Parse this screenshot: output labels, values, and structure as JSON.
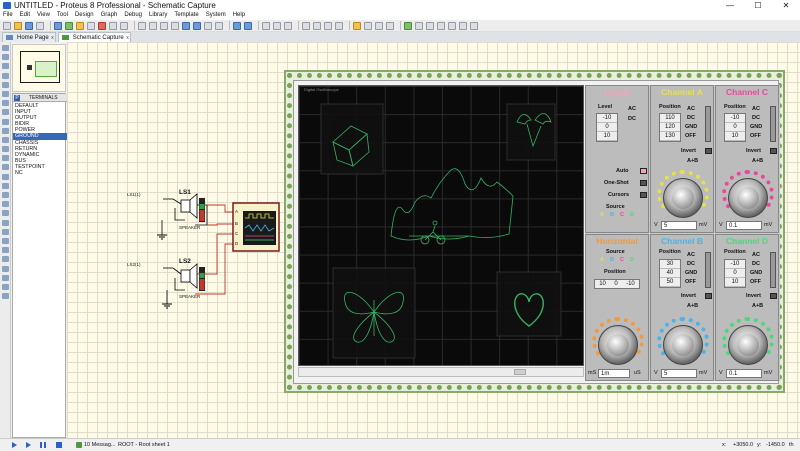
{
  "window": {
    "title": "UNTITLED - Proteus 8 Professional - Schematic Capture",
    "min": "—",
    "max": "☐",
    "close": "✕"
  },
  "menu": [
    "File",
    "Edit",
    "View",
    "Tool",
    "Design",
    "Graph",
    "Debug",
    "Library",
    "Template",
    "System",
    "Help"
  ],
  "tabs": [
    {
      "label": "Home Page",
      "active": false
    },
    {
      "label": "Schematic Capture",
      "active": true
    }
  ],
  "tab_close": "x",
  "terminals": {
    "p_label": "P",
    "header": "TERMINALS",
    "items": [
      "DEFAULT",
      "INPUT",
      "OUTPUT",
      "BIDIR",
      "POWER",
      "GROUND",
      "CHASSIS",
      "RETURN",
      "DYNAMIC",
      "BUS",
      "TESTPOINT",
      "NC"
    ],
    "selected": "GROUND"
  },
  "schematic": {
    "ls1": {
      "name": "LS1",
      "part": "SPEAKER",
      "net": "LS1(1)"
    },
    "ls2": {
      "name": "LS2",
      "part": "SPEAKER",
      "net": "LS2(1)"
    },
    "scope_pins": [
      "A",
      "B",
      "C",
      "D"
    ]
  },
  "oscilloscope": {
    "scope_title": "Digital Oscilloscope",
    "trigger": {
      "title": "Trigger",
      "level_label": "Level",
      "level_values": [
        "-10",
        "0",
        "10"
      ],
      "ac": "AC",
      "dc": "DC",
      "auto": "Auto",
      "oneshot": "One-Shot",
      "cursors": "Cursors",
      "source_label": "Source",
      "source_opts": [
        "A",
        "B",
        "C",
        "D"
      ]
    },
    "channel_a": {
      "title": "Channel A",
      "position_label": "Position",
      "pos_values": [
        "110",
        "120",
        "130"
      ],
      "modes": [
        "AC",
        "DC",
        "GND",
        "OFF"
      ],
      "invert": "Invert",
      "apb": "A+B",
      "volts": "5",
      "unit_l": "V",
      "unit_r": "mV"
    },
    "channel_c": {
      "title": "Channel C",
      "position_label": "Position",
      "pos_values": [
        "-10",
        "0",
        "10"
      ],
      "modes": [
        "AC",
        "DC",
        "GND",
        "OFF"
      ],
      "invert": "Invert",
      "apb": "A+B",
      "volts": "0.1",
      "unit_l": "V",
      "unit_r": "mV"
    },
    "horizontal": {
      "title": "Horizontal",
      "source_label": "Source",
      "source_opts": [
        "A",
        "B",
        "C",
        "D"
      ],
      "position_label": "Position",
      "pos_values": [
        "10",
        "0",
        "-10"
      ],
      "time": "1m",
      "unit_l": "mS",
      "unit_r": "uS"
    },
    "channel_b": {
      "title": "Channel B",
      "position_label": "Position",
      "pos_values": [
        "30",
        "40",
        "50"
      ],
      "modes": [
        "AC",
        "DC",
        "GND",
        "OFF"
      ],
      "invert": "Invert",
      "apb": "A+B",
      "volts": "5",
      "unit_l": "V",
      "unit_r": "mV"
    },
    "channel_d": {
      "title": "Channel D",
      "position_label": "Position",
      "pos_values": [
        "-10",
        "0",
        "10"
      ],
      "modes": [
        "AC",
        "DC",
        "GND",
        "OFF"
      ],
      "invert": "Invert",
      "apb": "A+B",
      "volts": "0.1",
      "unit_l": "V",
      "unit_r": "mV"
    },
    "colors": {
      "trace": "#3ec46d",
      "trigger": "#f2a6b4",
      "chA": "#e6e04a",
      "chB": "#4ab3e8",
      "chC": "#e84a9a",
      "chD": "#4ad87a",
      "horiz": "#f29a3a"
    }
  },
  "status": {
    "messages": "10 Messag...",
    "sheet": "ROOT - Root sheet 1",
    "x": "+3050.0",
    "y": "-1450.0",
    "unit": "th"
  }
}
